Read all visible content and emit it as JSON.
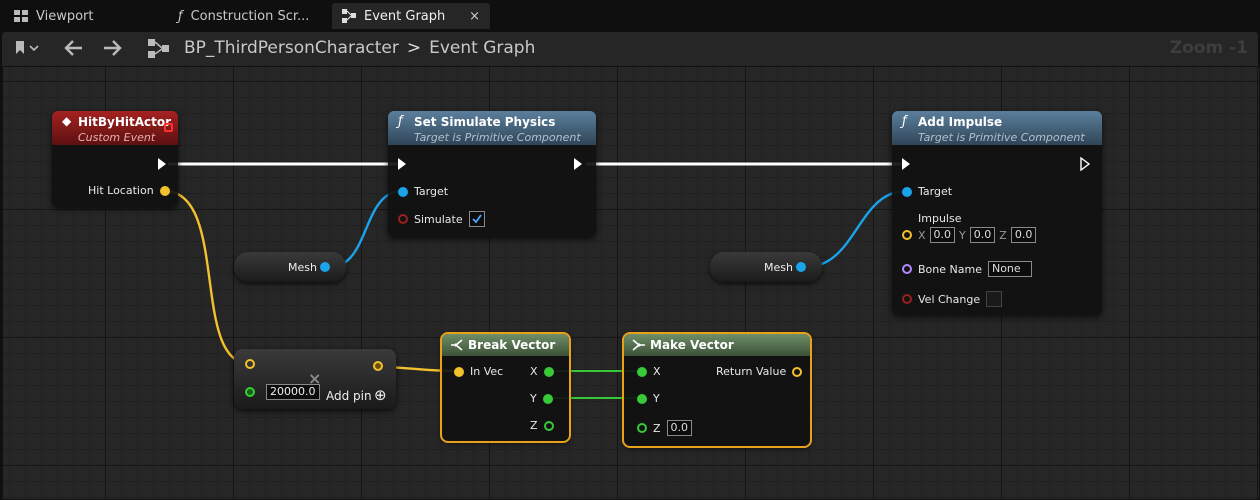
{
  "tabs": [
    {
      "label": "Viewport",
      "icon": "viewport-grid-icon"
    },
    {
      "label": "Construction Scr...",
      "icon": "function-icon"
    },
    {
      "label": "Event Graph",
      "icon": "event-graph-icon",
      "close": "×"
    }
  ],
  "toolbar": {
    "breadcrumb_root": "BP_ThirdPersonCharacter",
    "breadcrumb_sep": ">",
    "breadcrumb_leaf": "Event Graph",
    "zoom": "Zoom -1"
  },
  "nodes": {
    "hit_event": {
      "title": "HitByHitActor",
      "subtitle": "Custom Event",
      "pin_out": "Hit Location",
      "icon": "◆"
    },
    "set_physics": {
      "title": "Set Simulate Physics",
      "subtitle": "Target is Primitive Component",
      "pin_target": "Target",
      "pin_simulate": "Simulate",
      "icon": "ƒ"
    },
    "add_impulse": {
      "title": "Add Impulse",
      "subtitle": "Target is Primitive Component",
      "pin_target": "Target",
      "pin_impulse": "Impulse",
      "x_label": "X",
      "y_label": "Y",
      "z_label": "Z",
      "x_value": "0.0",
      "y_value": "0.0",
      "z_value": "0.0",
      "pin_bone": "Bone Name",
      "bone_value": "None",
      "pin_vel": "Vel Change",
      "icon": "ƒ"
    },
    "mesh_1": {
      "label": "Mesh"
    },
    "mesh_2": {
      "label": "Mesh"
    },
    "multiply": {
      "symbol": "×",
      "value": "20000.0",
      "add_pin": "Add pin",
      "add_icon": "⊕"
    },
    "break_vector": {
      "title": "Break Vector",
      "pin_in": "In Vec",
      "out_x": "X",
      "out_y": "Y",
      "out_z": "Z"
    },
    "make_vector": {
      "title": "Make Vector",
      "in_x": "X",
      "in_y": "Y",
      "in_z": "Z",
      "z_value": "0.0",
      "out": "Return Value"
    }
  },
  "colors": {
    "exec": "#ffffff",
    "vector": "#f2c12e",
    "object": "#1aa3e8",
    "float": "#37c937",
    "bool": "#9b1f1f",
    "name": "#b388ff",
    "event_header": "#8c1c1c",
    "function_header": "#4a6e8a",
    "pure_header": "#5a7a55",
    "selection": "#e8a21a"
  }
}
